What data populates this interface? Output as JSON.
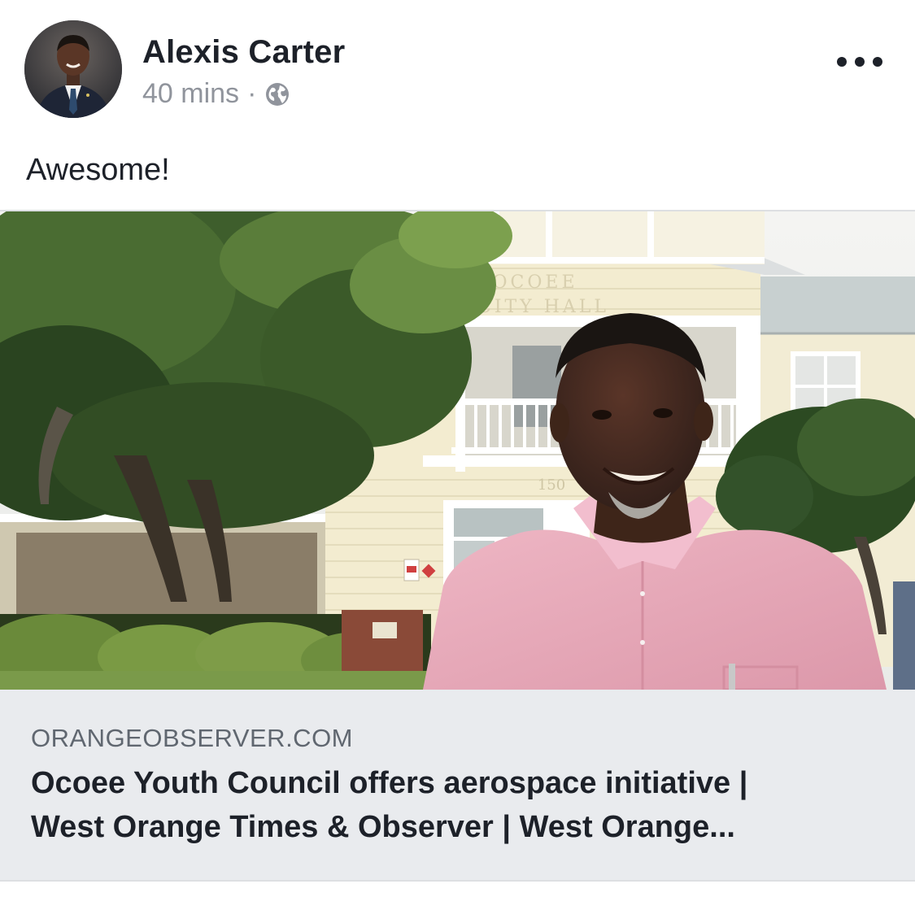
{
  "post": {
    "author": "Alexis Carter",
    "time": "40 mins",
    "separator": "·",
    "privacy_icon": "globe-icon",
    "more_icon": "more-dots-icon",
    "text": "Awesome!"
  },
  "link": {
    "image_text": {
      "sign_line1": "OCOEE",
      "sign_line2": "CITY HALL",
      "address": "150"
    },
    "domain": "ORANGEOBSERVER.COM",
    "title_line1": "Ocoee Youth Council offers aerospace initiative |",
    "title_line2": "West Orange Times & Observer | West Orange..."
  },
  "colors": {
    "name": "#1d2129",
    "meta": "#90949c",
    "link_bg": "#e9ebee",
    "shirt": "#e8a8b8"
  }
}
